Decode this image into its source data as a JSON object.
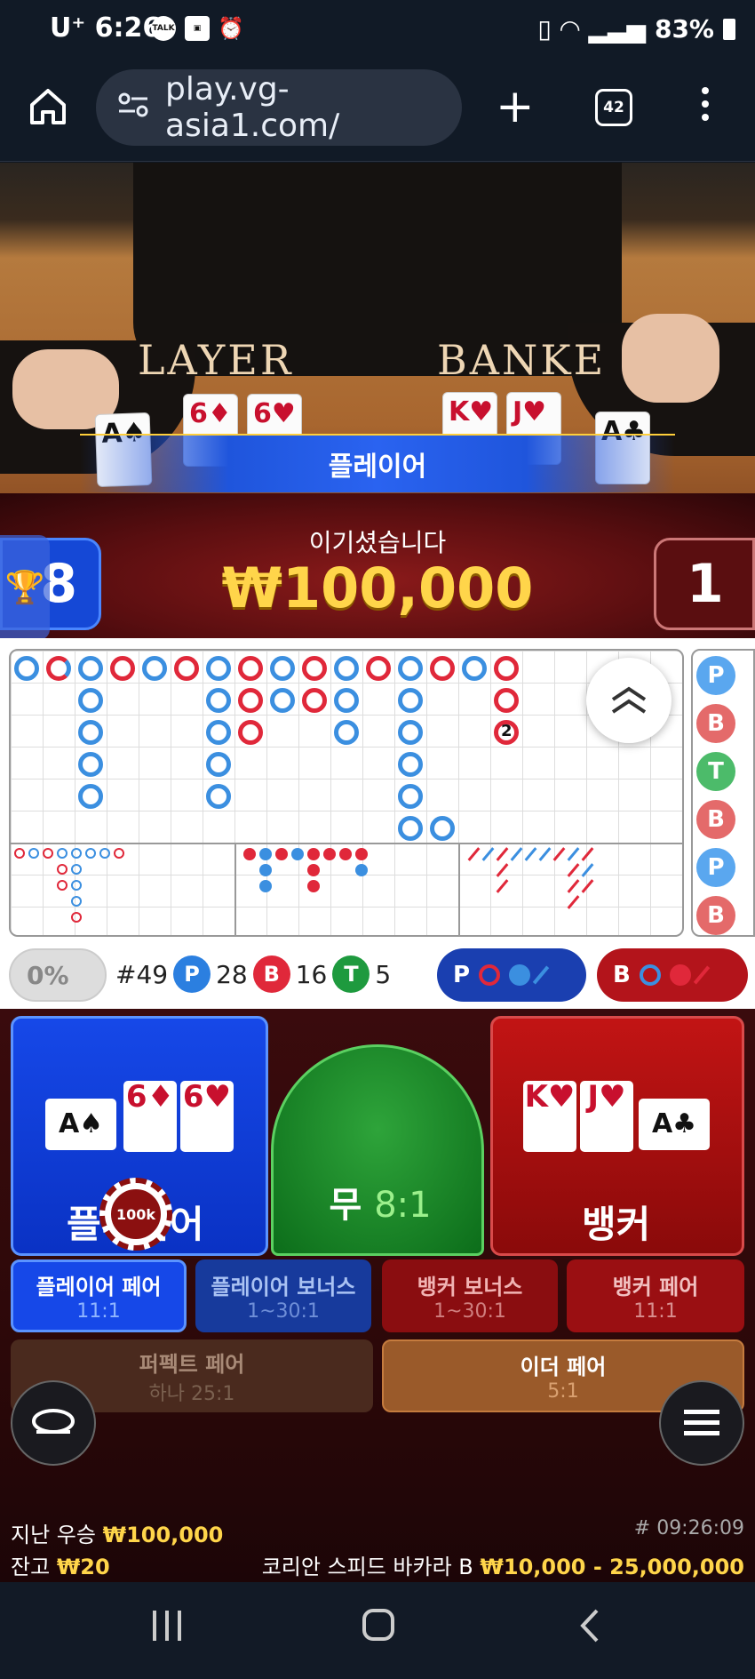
{
  "status_bar": {
    "time": "6:26",
    "carrier": "U⁺",
    "battery": "83%",
    "talk_icon_label": "TALK"
  },
  "browser": {
    "url": "play.vg-asia1.com/",
    "tab_count": "42"
  },
  "video": {
    "player_table_label": "LAYER",
    "banker_table_label": "BANKE",
    "player_cards": [
      "A♠",
      "6♦",
      "6♥"
    ],
    "banker_cards": [
      "K♥",
      "J♥",
      "A♣"
    ],
    "result_banner": "플레이어"
  },
  "win": {
    "message": "이기셨습니다",
    "amount": "₩100,000",
    "player_score": "8",
    "banker_score": "1"
  },
  "roadmap": {
    "side_labels": [
      "P",
      "B",
      "T",
      "B",
      "P",
      "B"
    ],
    "pair_mark": "2"
  },
  "stats": {
    "percent": "0%",
    "round": "#49",
    "p_label": "P",
    "p_count": "28",
    "b_label": "B",
    "b_count": "16",
    "t_label": "T",
    "t_count": "5",
    "ask_player": "P",
    "ask_banker": "B"
  },
  "bets": {
    "player_label": "플레이어",
    "banker_label": "뱅커",
    "tie_label": "무",
    "tie_odds": "8:1",
    "chip_value": "100k",
    "player_cards": [
      "A♠",
      "6♦",
      "6♥"
    ],
    "banker_cards": [
      "K♥",
      "J♥",
      "A♣"
    ],
    "side_bets": [
      {
        "label": "플레이어 페어",
        "odds": "11:1"
      },
      {
        "label": "플레이어 보너스",
        "odds": "1~30:1"
      },
      {
        "label": "뱅커 보너스",
        "odds": "1~30:1"
      },
      {
        "label": "뱅커 페어",
        "odds": "11:1"
      }
    ],
    "perfect_pair": {
      "label": "퍼펙트 페어",
      "odds": "하나 25:1"
    },
    "either_pair": {
      "label": "이더 페어",
      "odds": "5:1"
    }
  },
  "footer": {
    "last_win_label": "지난 우승",
    "last_win_amount": "₩100,000",
    "balance_label": "잔고",
    "balance_amount": "₩20",
    "round_id": "# 09:26:09",
    "table_name": "코리안 스피드 바카라 B",
    "limits": "₩10,000 - 25,000,000"
  },
  "colors": {
    "player": "#1648e8",
    "banker": "#c21414",
    "tie": "#2ea43a",
    "win_gold": "#ffd54a"
  }
}
